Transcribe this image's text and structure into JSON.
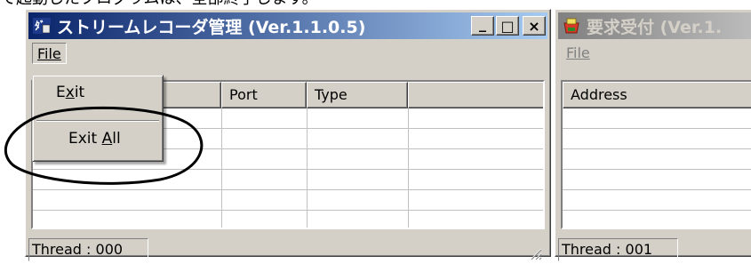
{
  "caption_text": "で起動したプログラムは、全部終了します。",
  "window1": {
    "title": "ストリームレコーダ管理 (Ver.1.1.0.5)",
    "menu": {
      "file": "File"
    },
    "columns": [
      "",
      "Port",
      "Type",
      ""
    ],
    "status": "Thread : 000",
    "caption_buttons": {
      "minimize": "_",
      "maximize": "□",
      "close": "×"
    }
  },
  "file_menu": {
    "items": [
      {
        "pre": "E",
        "accel": "x",
        "post": "it"
      },
      {
        "pre": "Exit ",
        "accel": "A",
        "post": "ll"
      }
    ]
  },
  "window2": {
    "title": "要求受付 (Ver.1.",
    "menu": {
      "file": "File"
    },
    "columns": [
      "Address"
    ],
    "status": "Thread : 001"
  },
  "annotation": {
    "color": "#000000",
    "shape": "ellipse"
  }
}
